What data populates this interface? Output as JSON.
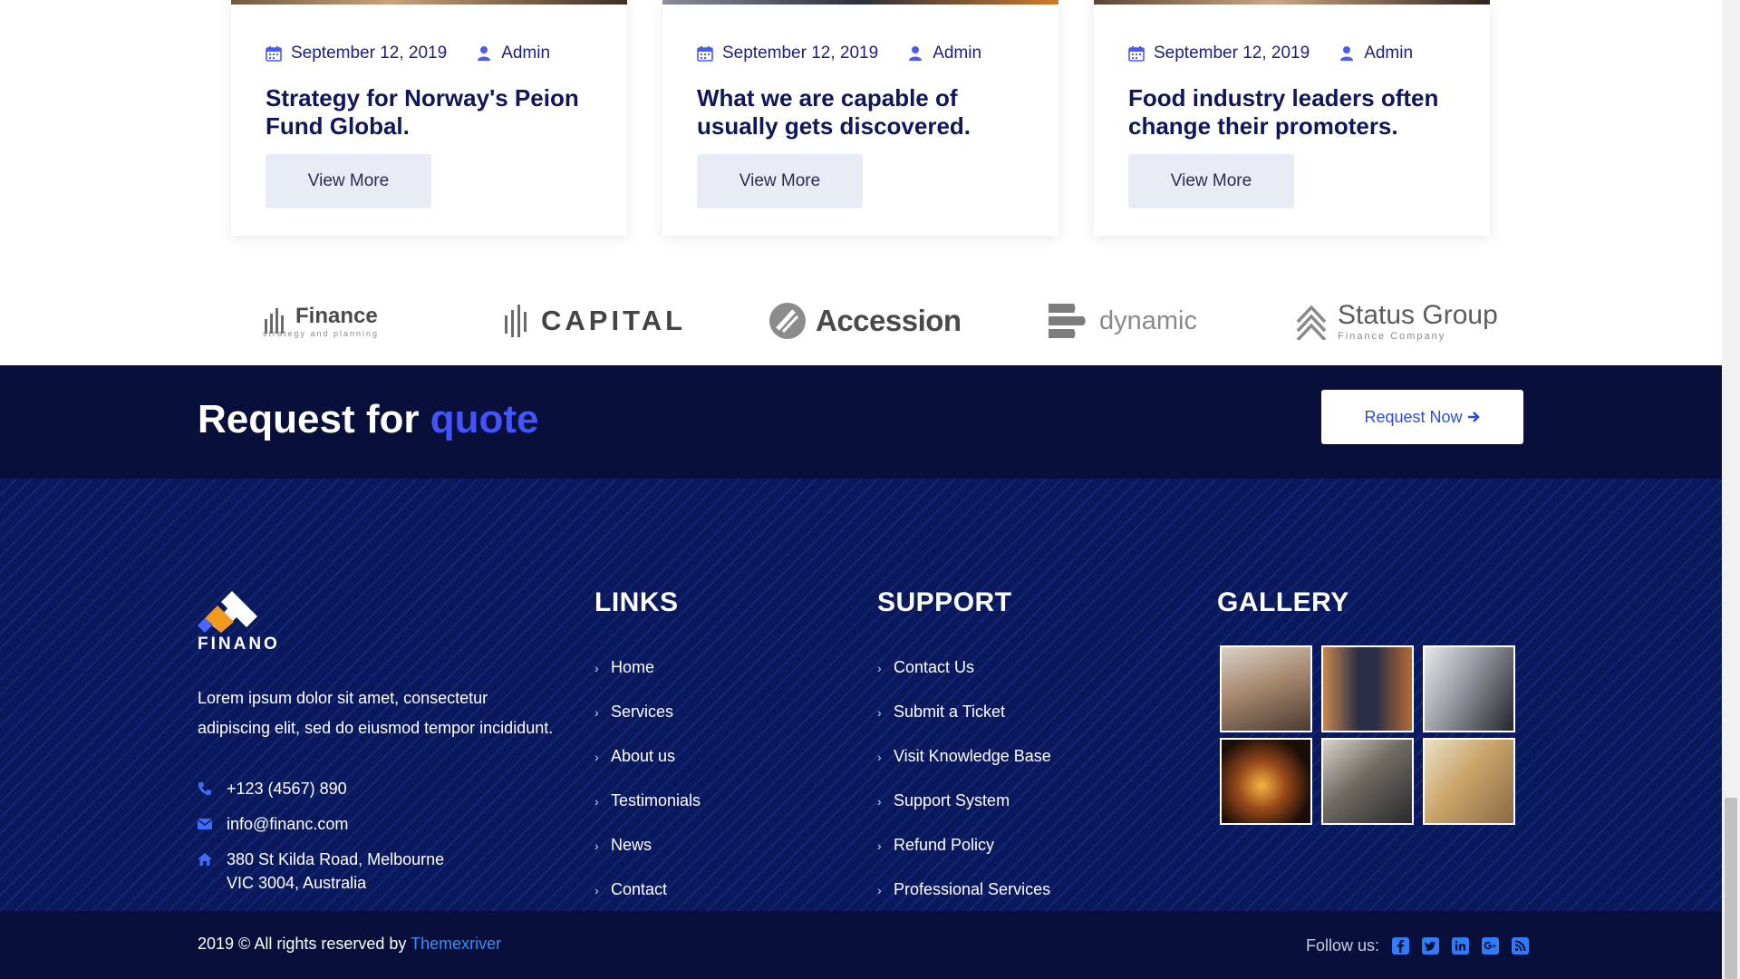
{
  "cards": [
    {
      "date": "September 12, 2019",
      "author": "Admin",
      "title": "Strategy for Norway's Peion Fund Global.",
      "button": "View More"
    },
    {
      "date": "September 12, 2019",
      "author": "Admin",
      "title": "What we are capable of usually gets discovered.",
      "button": "View More"
    },
    {
      "date": "September 12, 2019",
      "author": "Admin",
      "title": "Food industry leaders often change their promoters.",
      "button": "View More"
    }
  ],
  "brands": [
    {
      "name": "Finance",
      "sub": "strategy and planning"
    },
    {
      "name": "CAPITAL",
      "sub": ""
    },
    {
      "name": "Accession",
      "sub": ""
    },
    {
      "name": "dynamic",
      "sub": ""
    },
    {
      "name": "Status Group",
      "sub": "Finance Company"
    }
  ],
  "quote": {
    "title_main": "Request for",
    "title_accent": "quote",
    "button": "Request Now"
  },
  "footer": {
    "logo_text": "FINANO",
    "about": "Lorem ipsum dolor sit amet, consectetur adipiscing elit, sed do eiusmod tempor incididunt.",
    "phone": "+123 (4567) 890",
    "email": "info@financ.com",
    "address_line1": "380 St Kilda Road, Melbourne",
    "address_line2": "VIC 3004, Australia",
    "links_title": "LINKS",
    "links": [
      "Home",
      "Services",
      "About us",
      "Testimonials",
      "News",
      "Contact"
    ],
    "support_title": "SUPPORT",
    "support": [
      "Contact Us",
      "Submit a Ticket",
      "Visit Knowledge Base",
      "Support System",
      "Refund Policy",
      "Professional Services"
    ],
    "gallery_title": "GALLERY"
  },
  "bottom": {
    "copyright": "2019 © All rights reserved by",
    "brand_link": "Themexriver",
    "follow_label": "Follow us:"
  },
  "colors": {
    "accent": "#4354ff",
    "navy": "#070f3a",
    "footer_bg": "#09195c",
    "link_blue": "#3e8ef7"
  },
  "icons": [
    "calendar-icon",
    "user-icon",
    "phone-icon",
    "mail-icon",
    "home-icon",
    "facebook-icon",
    "twitter-icon",
    "linkedin-icon",
    "google-plus-icon",
    "rss-icon"
  ]
}
